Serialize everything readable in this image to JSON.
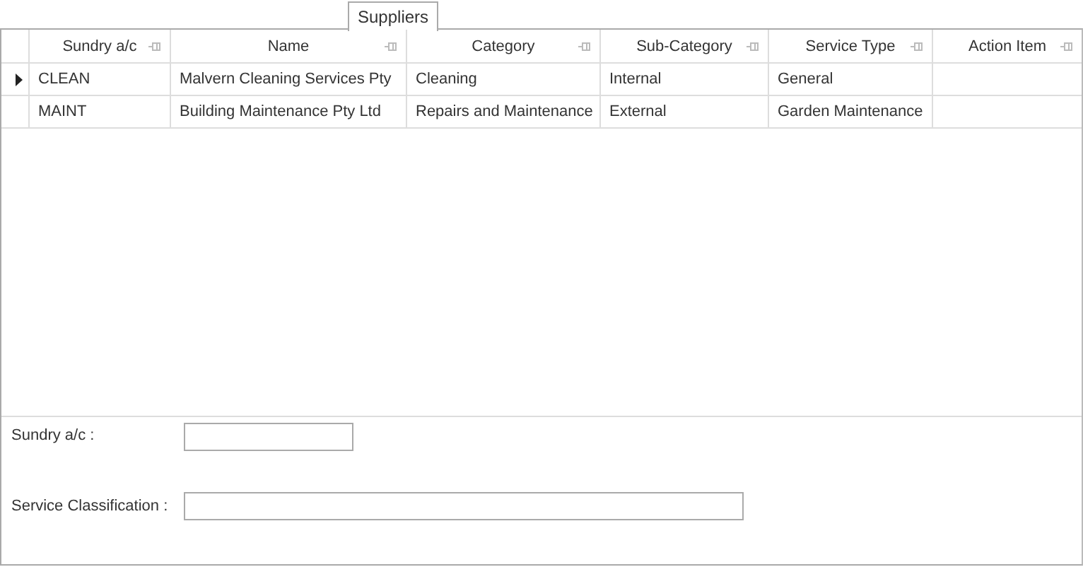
{
  "tabs": [
    {
      "label": "Suppliers",
      "selected": true
    }
  ],
  "table": {
    "columns": [
      "Sundry a/c",
      "Name",
      "Category",
      "Sub-Category",
      "Service Type",
      "Action Item"
    ],
    "rows": [
      {
        "selected": true,
        "cells": [
          "CLEAN",
          "Malvern Cleaning Services Pty",
          "Cleaning",
          "Internal",
          "General"
        ]
      },
      {
        "selected": false,
        "cells": [
          "MAINT",
          "Building Maintenance Pty Ltd",
          "Repairs and Maintenance",
          "External",
          "Garden Maintenance"
        ]
      }
    ]
  },
  "form": {
    "fields": [
      {
        "label": "Sundry a/c :"
      },
      {
        "label": "Service Classification :"
      }
    ]
  }
}
